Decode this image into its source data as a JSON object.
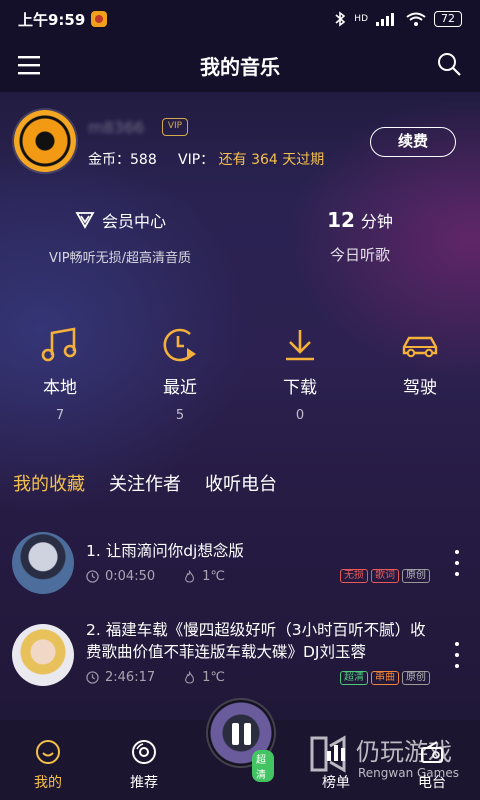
{
  "status_bar": {
    "time": "上午9:59",
    "network_label": "HD",
    "battery": "72"
  },
  "header": {
    "title": "我的音乐"
  },
  "profile": {
    "username": "m8366",
    "vip_badge": "VIP",
    "coins_label": "金币：",
    "coins_value": "588",
    "vip_label": "VIP：",
    "vip_prefix": "还有",
    "vip_days": "364",
    "vip_suffix": "天过期",
    "renew_label": "续费"
  },
  "stats": {
    "member_center_label": "会员中心",
    "member_center_sub": "VIP畅听无损/超高清音质",
    "listen_minutes": "12",
    "listen_unit": "分钟",
    "listen_sub": "今日听歌"
  },
  "quick_access": [
    {
      "label": "本地",
      "count": "7",
      "icon": "music-note-icon"
    },
    {
      "label": "最近",
      "count": "5",
      "icon": "clock-play-icon"
    },
    {
      "label": "下载",
      "count": "0",
      "icon": "download-icon"
    },
    {
      "label": "驾驶",
      "count": "",
      "icon": "car-icon"
    }
  ],
  "tabs": [
    {
      "label": "我的收藏",
      "active": true
    },
    {
      "label": "关注作者",
      "active": false
    },
    {
      "label": "收听电台",
      "active": false
    }
  ],
  "songs": [
    {
      "title": "1. 让雨滴问你dj想念版",
      "duration": "0:04:50",
      "heat": "1℃",
      "tags": [
        "无损",
        "歌词",
        "原创"
      ]
    },
    {
      "title": "2. 福建车载《慢四超级好听（3小时百听不腻）收费歌曲价值不菲连版车载大碟》DJ刘玉蓉",
      "duration": "2:46:17",
      "heat": "1℃",
      "tags": [
        "超清",
        "串曲",
        "原创"
      ]
    }
  ],
  "nav": {
    "mine": "我的",
    "recommend": "推荐",
    "player_badge": "超清",
    "chart": "榜单",
    "radio": "电台"
  },
  "watermark": {
    "cn": "仍玩游戏",
    "en": "Rengwan Games"
  },
  "colors": {
    "accent_gold": "#f5c04a",
    "header_bg": "#14102a",
    "tag_red": "#e85a5a",
    "tag_green": "#4cc97a"
  }
}
